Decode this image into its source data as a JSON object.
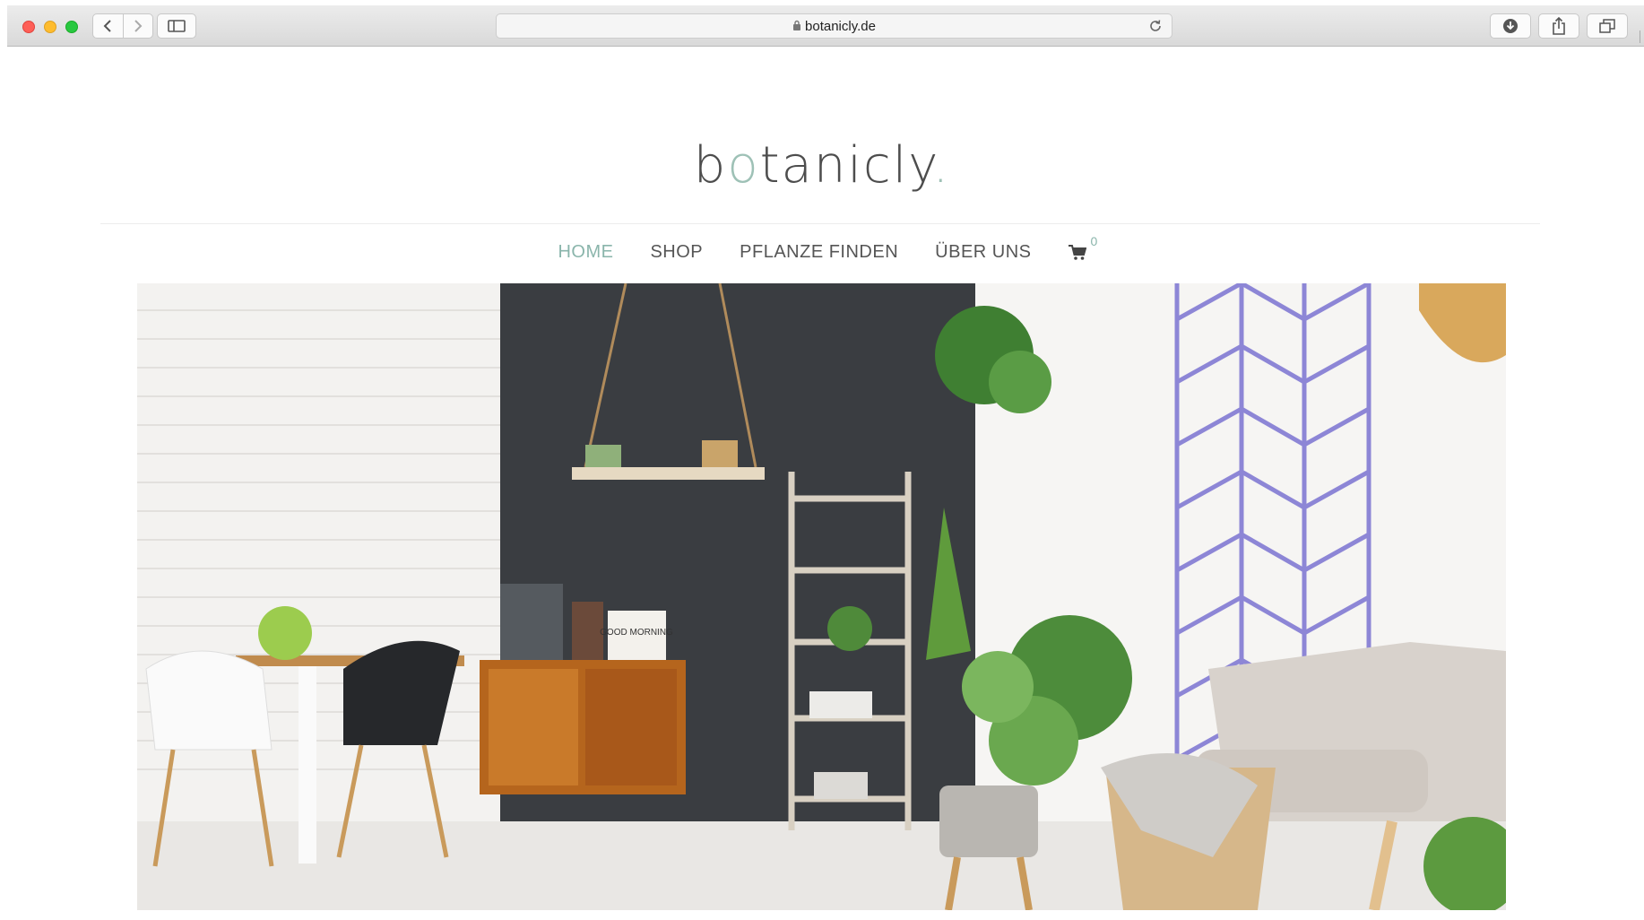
{
  "browser": {
    "url": "botanicly.de",
    "icons": [
      "back-icon",
      "forward-icon",
      "sidebar-icon",
      "lock-icon",
      "reload-icon",
      "download-icon",
      "share-icon",
      "tabs-icon"
    ]
  },
  "site": {
    "logo_main": "b",
    "logo_accent_o": "o",
    "logo_rest": "tanicly",
    "logo_dot": ".",
    "accent_color": "#9ec1b6"
  },
  "nav": {
    "home": "HOME",
    "shop": "SHOP",
    "finder": "PFLANZE FINDEN",
    "about": "ÜBER UNS",
    "cart_count": "0"
  },
  "hero": {
    "sign_text": "GOOD MORNING"
  }
}
